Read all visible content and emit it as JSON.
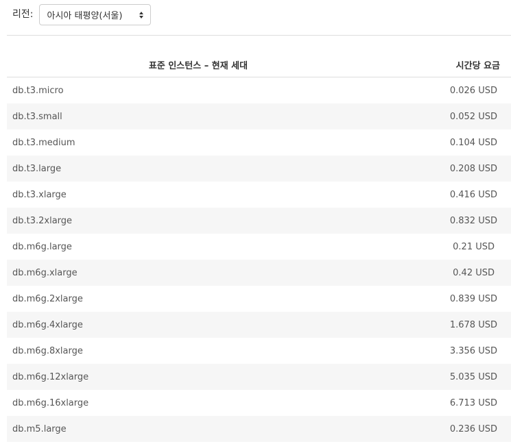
{
  "region": {
    "label": "리전:",
    "selected": "아시아 태평양(서울)"
  },
  "table": {
    "header_instance": "표준 인스턴스 – 현재 세대",
    "header_price": "시간당 요금",
    "rows": [
      {
        "instance": "db.t3.micro",
        "price": "0.026 USD"
      },
      {
        "instance": "db.t3.small",
        "price": "0.052 USD"
      },
      {
        "instance": "db.t3.medium",
        "price": "0.104 USD"
      },
      {
        "instance": "db.t3.large",
        "price": "0.208 USD"
      },
      {
        "instance": "db.t3.xlarge",
        "price": "0.416 USD"
      },
      {
        "instance": "db.t3.2xlarge",
        "price": "0.832 USD"
      },
      {
        "instance": "db.m6g.large",
        "price": "0.21 USD"
      },
      {
        "instance": "db.m6g.xlarge",
        "price": "0.42 USD"
      },
      {
        "instance": "db.m6g.2xlarge",
        "price": "0.839 USD"
      },
      {
        "instance": "db.m6g.4xlarge",
        "price": "1.678 USD"
      },
      {
        "instance": "db.m6g.8xlarge",
        "price": "3.356 USD"
      },
      {
        "instance": "db.m6g.12xlarge",
        "price": "5.035 USD"
      },
      {
        "instance": "db.m6g.16xlarge",
        "price": "6.713 USD"
      },
      {
        "instance": "db.m5.large",
        "price": "0.236 USD"
      }
    ]
  },
  "colors": {
    "row_alt_background": "#f6f6f6",
    "border": "#dddddd",
    "text": "#333333"
  },
  "icons": {
    "select_arrows": "sort-arrows-icon"
  }
}
